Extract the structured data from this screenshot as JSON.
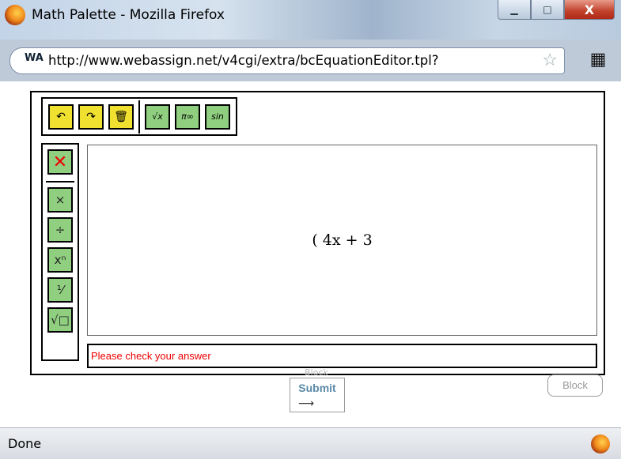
{
  "window": {
    "title": "Math Palette - Mozilla Firefox",
    "close_glyph": "X",
    "minimize_glyph": "▁",
    "maximize_glyph": "□"
  },
  "address": {
    "url": "http://www.webassign.net/v4cgi/extra/bcEquationEditor.tpl?",
    "site_icon_label": "WA",
    "menu_glyph": "▦"
  },
  "palette": {
    "toolbar": {
      "undo_glyph": "↶",
      "redo_glyph": "↷",
      "delete_glyph": "🗑",
      "sqrt_label": "√x",
      "pi_label": "π∞",
      "sin_label": "sin"
    },
    "sidebar": {
      "clear_glyph": "✕",
      "times_glyph": "×",
      "divide_glyph": "÷",
      "power_label": "xⁿ",
      "fraction_label": "⅟",
      "root_label": "√□"
    },
    "expression": "( 4x + 3",
    "message": "Please check your answer"
  },
  "buttons": {
    "submit_label": "Submit",
    "submit_arrow": "⟶",
    "block_label": "Block",
    "ghost_block_label": "Block"
  },
  "status": {
    "text": "Done"
  },
  "colors": {
    "toolbar_yellow": "#f0e030",
    "toolbar_green": "#8fcf7f",
    "error_red": "#e00000"
  }
}
